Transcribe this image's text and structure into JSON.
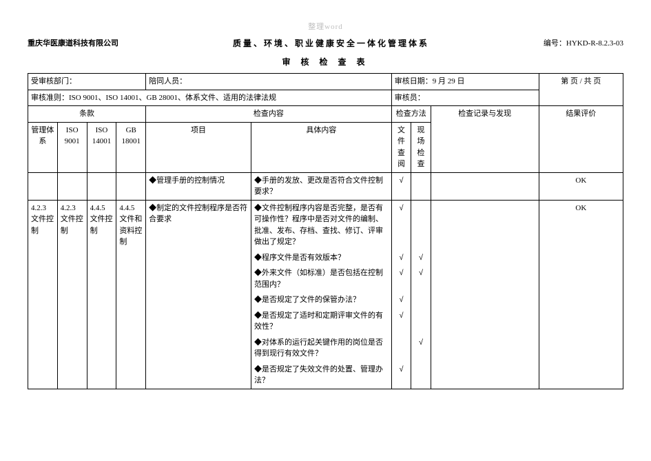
{
  "watermark": "整理word",
  "company": "重庆华医康道科技有限公司",
  "doc_no_label": "编号：",
  "doc_no": "HYKD-R-8.2.3-03",
  "title": "质量、环境、职业健康安全一体化管理体系",
  "subtitle": "审 核 检 查 表",
  "meta": {
    "dept_label": "受审核部门：",
    "dept_value": "",
    "companion_label": "陪同人员：",
    "companion_value": "",
    "date_label": "审核日期：",
    "date_value": "9 月 29 日",
    "criteria_label": "审核准则：",
    "criteria_value": "ISO 9001、ISO 14001、GB 28001、体系文件、适用的法律法规",
    "auditor_label": "审核员：",
    "auditor_value": "",
    "page_cell": "第      页 / 共      页"
  },
  "head": {
    "clause_group": "条款",
    "mgmt": "管理体系",
    "iso9001": "ISO 9001",
    "iso14001": "ISO 14001",
    "gb18001": "GB 18001",
    "check_content_group": "检查内容",
    "project": "项目",
    "detail": "具体内容",
    "method_group": "检查方法",
    "doc_review": "文件查阅",
    "site_check": "现场检查",
    "record": "检查记录与发现",
    "result": "结果评价"
  },
  "row1": {
    "project": "◆管理手册的控制情况",
    "detail": "◆手册的发放、更改是否符合文件控制要求？",
    "doc_chk": "√",
    "site_chk": "",
    "result": "OK"
  },
  "row2": {
    "mgmt": "4.2.3 文件控制",
    "iso9001": "4.2.3 文件控制",
    "iso14001": "4.4.5 文件控制",
    "gb18001": "4.4.5 文件和资料控制",
    "project": "◆制定的文件控制程序是否符合要求",
    "details": {
      "d1": "◆文件控制程序内容是否完整，是否有可操作性？程序中是否对文件的编制、批准、发布、存档、查找、修订、评审做出了规定？",
      "d2": "◆程序文件是否有效版本？",
      "d3": "◆外来文件（如标准）是否包括在控制范围内？",
      "d4": "◆是否规定了文件的保管办法？",
      "d5": "◆是否规定了适时和定期评审文件的有效性？",
      "d6": "◆对体系的运行起关键作用的岗位是否得到现行有效文件？",
      "d7": "◆是否规定了失效文件的处置、管理办法？"
    },
    "chk": {
      "d1_doc": "√",
      "d1_site": "",
      "d2_doc": "√",
      "d2_site": "√",
      "d3_doc": "√",
      "d3_site": "√",
      "d4_doc": "√",
      "d4_site": "",
      "d5_doc": "√",
      "d5_site": "",
      "d6_doc": "",
      "d6_site": "√",
      "d7_doc": "√",
      "d7_site": ""
    },
    "result": "OK"
  }
}
